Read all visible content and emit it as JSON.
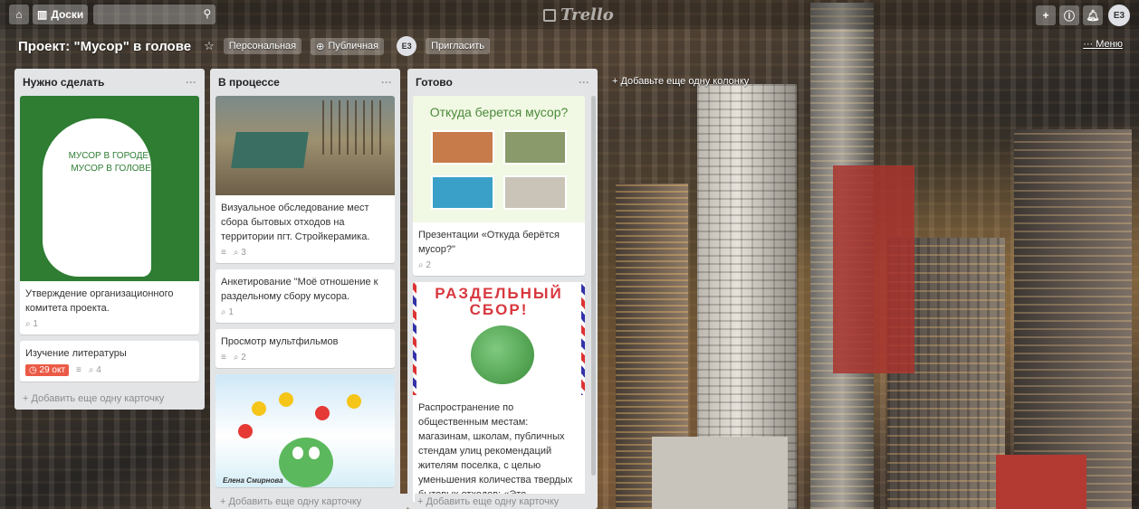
{
  "topbar": {
    "home_icon": "home-icon",
    "boards_label": "Доски",
    "search_icon": "search-icon",
    "logo_text": "Trello",
    "add_icon": "plus-icon",
    "info_icon": "info-icon",
    "bell_icon": "bell-icon",
    "avatar_initials": "E3"
  },
  "board": {
    "title": "Проект: \"Мусор\" в голове",
    "visibility_personal": "Персональная",
    "visibility_public": "Публичная",
    "member_initials": "E3",
    "invite_label": "Пригласить",
    "menu_label": "Меню",
    "add_list_label": "+ Добавьте еще одну колонку"
  },
  "lists": [
    {
      "title": "Нужно сделать",
      "cards": [
        {
          "cover_text": "МУСОР В ГОРОДЕ – МУСОР В ГОЛОВЕ!",
          "title": "Утверждение организационного комитета проекта.",
          "attachments": "1"
        },
        {
          "title": "Изучение литературы",
          "due": "29 окт",
          "attachments": "4"
        }
      ],
      "add_card": "+ Добавить еще одну карточку"
    },
    {
      "title": "В процессе",
      "cards": [
        {
          "title": "Визуальное обследование мест сбора бытовых отходов на территории пгт. Стройкерамика.",
          "attachments": "3"
        },
        {
          "title": "Анкетирование \"Моё отношение к раздельному сбору мусора.",
          "attachments": "1"
        },
        {
          "title": "Просмотр мультфильмов",
          "attachments": "2"
        },
        {
          "cover_caption": "Елена Смирнова"
        }
      ],
      "add_card": "+ Добавить еще одну карточку"
    },
    {
      "title": "Готово",
      "cards": [
        {
          "cover_text": "Откуда берется мусор?",
          "title": "Презентации «Откуда берётся мусор?\"",
          "attachments": "2"
        },
        {
          "cover_text": "РАЗДЕЛЬНЫЙ СБОР!",
          "title": "Распространение по общественным местам: магазинам, школам, публичных стендам улиц рекомендаций жителям поселка, с целью уменьшения количества твердых бытовых отходов: «Это"
        }
      ],
      "add_card": "+ Добавить еще одну карточку"
    }
  ],
  "colors": {
    "list_bg": "#e2e4e6",
    "due_badge": "#eb5a46",
    "cover_green": "#2e7d32"
  }
}
